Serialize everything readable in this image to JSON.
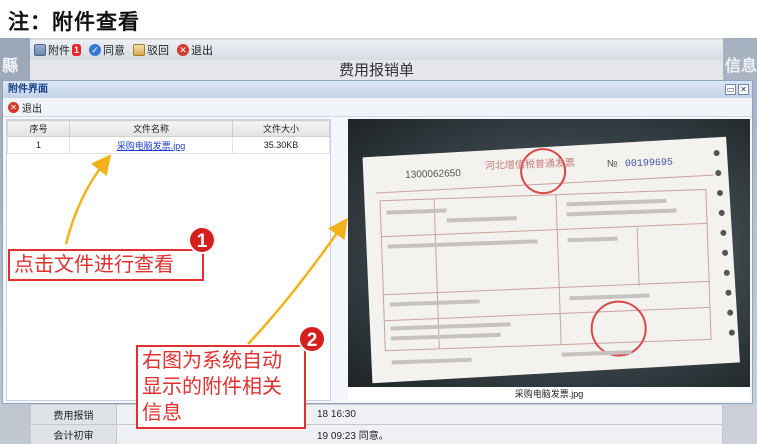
{
  "note_title": "注：附件查看",
  "background_window": {
    "left_strip_text": "縣协",
    "right_strip_text": "信息",
    "toolbar": [
      {
        "label": "附件",
        "icon": "attachment-icon"
      },
      {
        "label": "同意",
        "icon": "approve-icon"
      },
      {
        "label": "驳回",
        "icon": "reject-icon"
      },
      {
        "label": "退出",
        "icon": "exit-icon"
      }
    ],
    "attachment_count": "1",
    "form_title": "费用报销单",
    "table_rows": [
      {
        "label": "费用报销",
        "value": "18 16:30"
      },
      {
        "label": "会计初审",
        "value": "19 09:23 同意。"
      }
    ]
  },
  "dialog": {
    "title": "附件界面",
    "minimize_label": "▭",
    "close_label": "✕",
    "toolbar_exit": "退出",
    "columns": [
      "序号",
      "文件名称",
      "文件大小"
    ],
    "rows": [
      {
        "index": "1",
        "name": "采购电脑发票.jpg",
        "size": "35.30KB"
      }
    ],
    "preview_caption": "采购电脑发票.jpg",
    "invoice": {
      "code": "1300062650",
      "header": "河北增值税普通发票",
      "number_prefix": "№",
      "number": "00199695"
    }
  },
  "annotations": {
    "callout1": "点击文件进行查看",
    "badge1": "1",
    "callout2_lines": [
      "右图为系统自动",
      "显示的附件相关",
      "信息"
    ],
    "badge2": "2"
  },
  "colors": {
    "annotation_red": "#e03030",
    "arrow_yellow": "#f2b21b",
    "link_blue": "#1a3fcc",
    "dialog_title_blue": "#15428b"
  }
}
